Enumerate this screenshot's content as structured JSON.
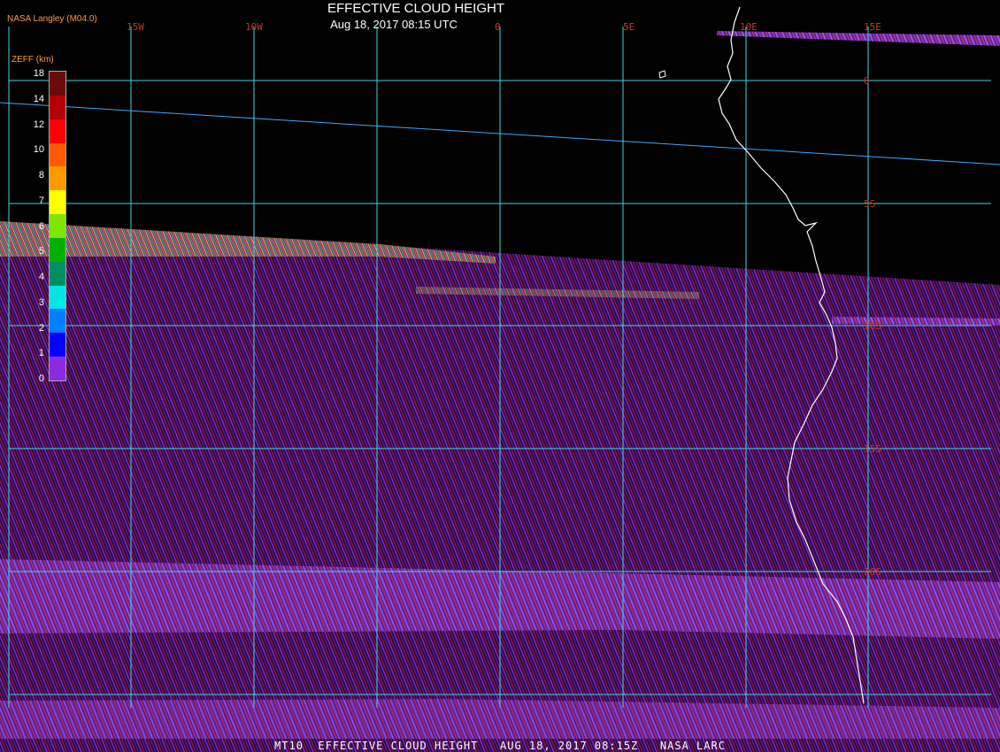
{
  "header": {
    "title": "EFFECTIVE CLOUD HEIGHT",
    "subtitle": "Aug 18, 2017 08:15 UTC",
    "product": "NASA Langley (M04.0)"
  },
  "legend": {
    "title": "ZEFF (km)",
    "ticks": [
      "18",
      "14",
      "12",
      "10",
      "8",
      "7",
      "6",
      "5",
      "4",
      "3",
      "2",
      "1",
      "0"
    ],
    "colors": [
      "#6b0a0a",
      "#b30000",
      "#ff0000",
      "#ff5a00",
      "#ff9a00",
      "#ffff00",
      "#7fe600",
      "#00b000",
      "#009060",
      "#00e6e6",
      "#0080ff",
      "#0000ff",
      "#8a2be2"
    ]
  },
  "grid": {
    "longitudes": [
      "15W",
      "10W",
      "0",
      "5E",
      "10E",
      "15E"
    ],
    "latitudes": [
      "0",
      "5S",
      "10S",
      "15S",
      "20S"
    ]
  },
  "footer": {
    "text": "MT10  EFFECTIVE CLOUD HEIGHT   AUG 18, 2017 08:15Z   NASA LARC"
  },
  "colors": {
    "gridline": "#3fd6e0",
    "coast": "#ffffff",
    "grid_label": "#c0392b"
  }
}
